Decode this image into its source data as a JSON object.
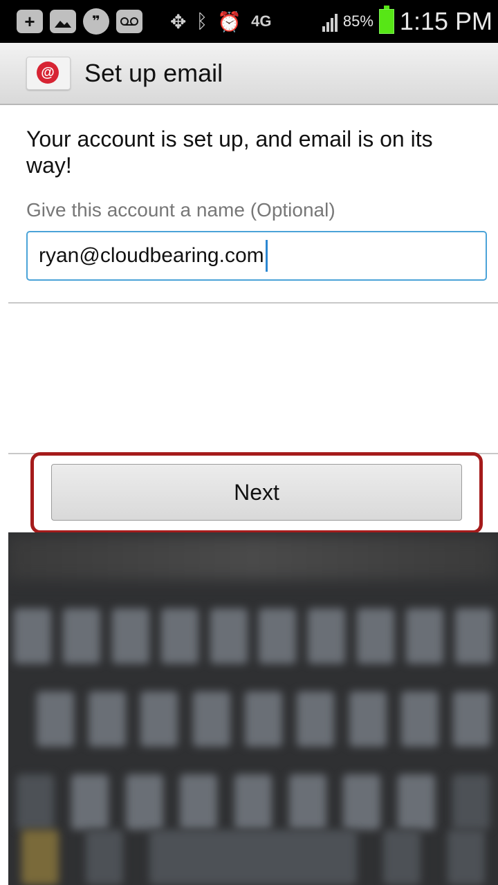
{
  "status_bar": {
    "battery_percent": "85%",
    "time": "1:15 PM",
    "network": "4G",
    "icons": [
      "add-icon",
      "image-icon",
      "hangouts-icon",
      "voicemail-icon",
      "location-target-icon",
      "bluetooth-icon",
      "alarm-icon",
      "network-4g-icon",
      "signal-icon",
      "battery-icon"
    ],
    "colors": {
      "background": "#000000",
      "battery": "#57e616"
    }
  },
  "action_bar": {
    "title": "Set up email",
    "icon": "email-app-icon",
    "icon_glyph": "@"
  },
  "content": {
    "headline": "Your account is set up, and email is on its way!",
    "name_label": "Give this account a name (Optional)",
    "name_value": "ryan@cloudbearing.com"
  },
  "buttons": {
    "next_label": "Next"
  },
  "accent_colors": {
    "input_border": "#4aa3d8",
    "highlight_outline": "#a51b1b"
  }
}
